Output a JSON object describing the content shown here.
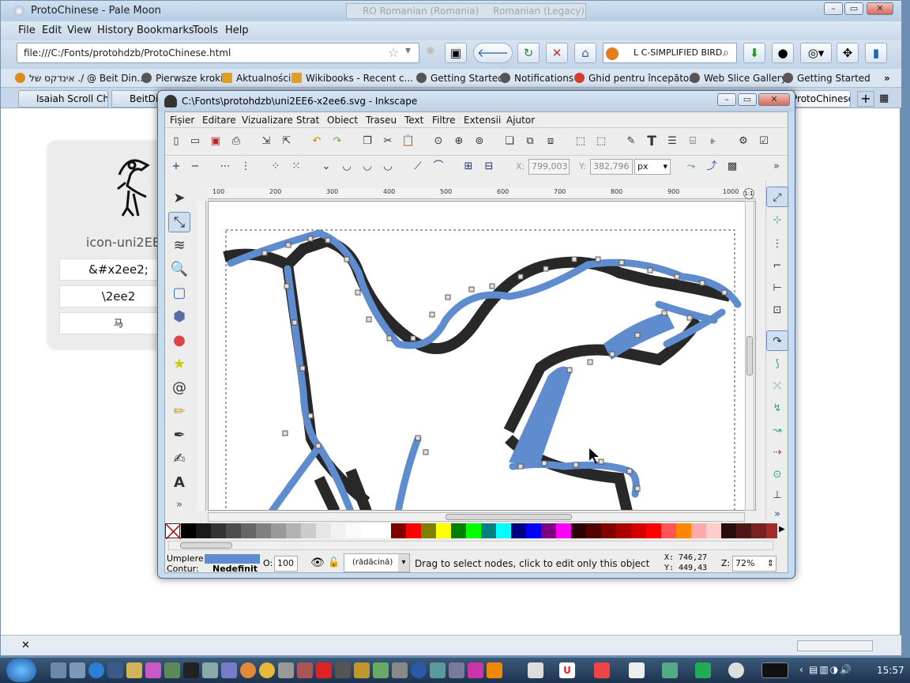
{
  "browser": {
    "title": "ProtoChinese - Pale Moon",
    "menu": [
      "File",
      "Edit",
      "View",
      "History",
      "Bookmarks",
      "Tools",
      "Help"
    ],
    "url": "file:///C:/Fonts/protohdzb/ProtoChinese.html",
    "search_text": "L C-SIMPLIFIED BIRD",
    "lang_overlay_1": "RO Romanian (Romania)",
    "lang_overlay_2": "Romanian (Legacy)",
    "bookmarks": [
      "./ @ Beit Din...",
      "Pierwsze kroki",
      "Aktualności",
      "Wikibooks - Recent c...",
      "Getting Started",
      "Notifications",
      "Ghid pentru începători",
      "Web Slice Gallery",
      "Getting Started"
    ],
    "bookmark_rtl_prefix": "אינדקס של",
    "tabs": [
      "Isaiah Scroll Ch...",
      "BeitDin",
      "ProtoChinese"
    ],
    "card": {
      "name": "icon-uni2EE2",
      "entity": "&#x2ee2;",
      "css_escape": "\\2ee2",
      "glyph": "⻢"
    }
  },
  "inkscape": {
    "title": "C:\\Fonts\\protohdzb\\uni2EE6-x2ee6.svg - Inkscape",
    "menu": [
      "Fișier",
      "Editare",
      "Vizualizare",
      "Strat",
      "Obiect",
      "Traseu",
      "Text",
      "Filtre",
      "Extensii",
      "Ajutor"
    ],
    "x_label": "X:",
    "x_value": "799,003",
    "y_label": "Y:",
    "y_value": "382,796",
    "unit": "px",
    "ruler": [
      "100",
      "200",
      "300",
      "400",
      "500",
      "600",
      "700",
      "800",
      "900",
      "1000"
    ],
    "fill_label": "Umplere:",
    "stroke_label": "Contur:",
    "stroke_value": "Nedefinit",
    "opacity_label": "O:",
    "opacity_value": "100",
    "layer": "(rădăcină)",
    "status": "Drag to select nodes, click to edit only this object",
    "coord_x": "746,27",
    "coord_y": "449,43",
    "zoom_label": "Z:",
    "zoom": "72%",
    "fill_color": "#5f8ccf"
  },
  "taskbar": {
    "time": "15:57"
  }
}
